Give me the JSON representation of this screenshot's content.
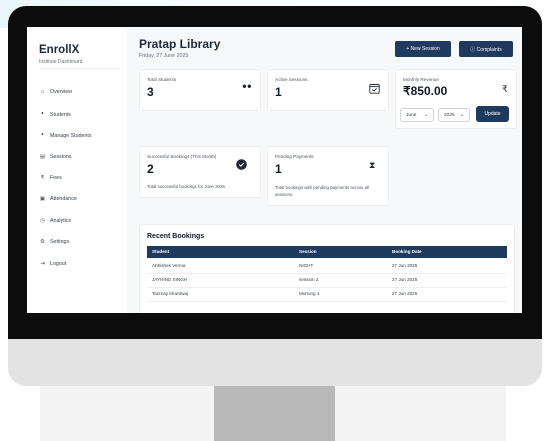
{
  "sidebar": {
    "brand": "EnrollX",
    "subtitle": "Institute Dashboard",
    "items": [
      {
        "label": "Overview",
        "icon": "home-icon"
      },
      {
        "label": "Students",
        "icon": "users-icon"
      },
      {
        "label": "Manage Students",
        "icon": "manage-users-icon"
      },
      {
        "label": "Sessions",
        "icon": "calendar-icon"
      },
      {
        "label": "Fees",
        "icon": "rupee-icon"
      },
      {
        "label": "Attendance",
        "icon": "attendance-calendar-icon"
      },
      {
        "label": "Analytics",
        "icon": "analytics-icon"
      },
      {
        "label": "Settings",
        "icon": "gear-icon"
      },
      {
        "label": "Logout",
        "icon": "logout-icon"
      }
    ]
  },
  "header": {
    "title": "Pratap Library",
    "date": "Friday, 27 June 2025",
    "new_session": "+  New Session",
    "complaints": "ⓘ  Complaints"
  },
  "stats": {
    "total_students": {
      "label": "Total Students",
      "value": "3"
    },
    "active_sessions": {
      "label": "Active Sessions",
      "value": "1"
    },
    "monthly_revenue": {
      "label": "Monthly Revenue",
      "value": "₹850.00",
      "month": "June",
      "year": "2025",
      "update": "Update"
    },
    "successful_bookings": {
      "label": "Successful Bookings (This Month)",
      "value": "2",
      "note": "Total successful bookings for June 2025."
    },
    "pending_payments": {
      "label": "Pending Payments",
      "value": "1",
      "note": "Total bookings with pending payments across all sessions."
    }
  },
  "bookings": {
    "title": "Recent Bookings",
    "columns": [
      "Student",
      "Session",
      "Booking Date"
    ],
    "rows": [
      [
        "Abhishek Verma",
        "NIGHT",
        "27 Jun 2025"
      ],
      [
        "JAYHIND SINGH",
        "session 2",
        "27 Jun 2025"
      ],
      [
        "Tanmay bhardwaj",
        "Morning 1",
        "27 Jun 2025"
      ]
    ]
  },
  "colors": {
    "accent": "#1e3a5f",
    "bezel": "#0c0c0c",
    "monitor": "#e3e3e3",
    "stand": "#b9b9b9"
  }
}
